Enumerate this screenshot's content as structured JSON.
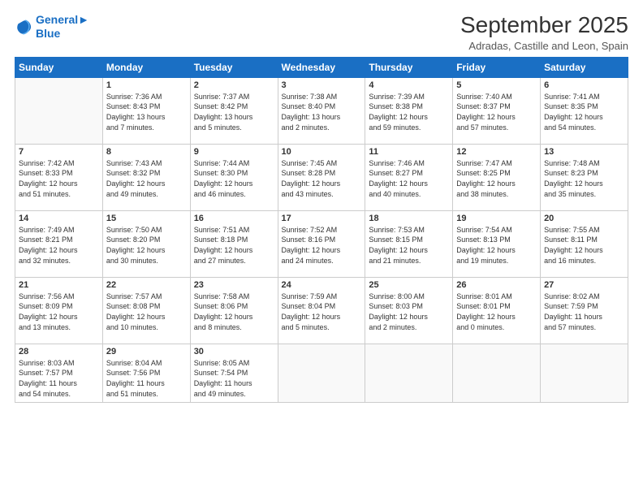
{
  "logo": {
    "line1": "General",
    "line2": "Blue"
  },
  "title": "September 2025",
  "subtitle": "Adradas, Castille and Leon, Spain",
  "days_of_week": [
    "Sunday",
    "Monday",
    "Tuesday",
    "Wednesday",
    "Thursday",
    "Friday",
    "Saturday"
  ],
  "weeks": [
    [
      {
        "num": "",
        "info": ""
      },
      {
        "num": "1",
        "info": "Sunrise: 7:36 AM\nSunset: 8:43 PM\nDaylight: 13 hours\nand 7 minutes."
      },
      {
        "num": "2",
        "info": "Sunrise: 7:37 AM\nSunset: 8:42 PM\nDaylight: 13 hours\nand 5 minutes."
      },
      {
        "num": "3",
        "info": "Sunrise: 7:38 AM\nSunset: 8:40 PM\nDaylight: 13 hours\nand 2 minutes."
      },
      {
        "num": "4",
        "info": "Sunrise: 7:39 AM\nSunset: 8:38 PM\nDaylight: 12 hours\nand 59 minutes."
      },
      {
        "num": "5",
        "info": "Sunrise: 7:40 AM\nSunset: 8:37 PM\nDaylight: 12 hours\nand 57 minutes."
      },
      {
        "num": "6",
        "info": "Sunrise: 7:41 AM\nSunset: 8:35 PM\nDaylight: 12 hours\nand 54 minutes."
      }
    ],
    [
      {
        "num": "7",
        "info": "Sunrise: 7:42 AM\nSunset: 8:33 PM\nDaylight: 12 hours\nand 51 minutes."
      },
      {
        "num": "8",
        "info": "Sunrise: 7:43 AM\nSunset: 8:32 PM\nDaylight: 12 hours\nand 49 minutes."
      },
      {
        "num": "9",
        "info": "Sunrise: 7:44 AM\nSunset: 8:30 PM\nDaylight: 12 hours\nand 46 minutes."
      },
      {
        "num": "10",
        "info": "Sunrise: 7:45 AM\nSunset: 8:28 PM\nDaylight: 12 hours\nand 43 minutes."
      },
      {
        "num": "11",
        "info": "Sunrise: 7:46 AM\nSunset: 8:27 PM\nDaylight: 12 hours\nand 40 minutes."
      },
      {
        "num": "12",
        "info": "Sunrise: 7:47 AM\nSunset: 8:25 PM\nDaylight: 12 hours\nand 38 minutes."
      },
      {
        "num": "13",
        "info": "Sunrise: 7:48 AM\nSunset: 8:23 PM\nDaylight: 12 hours\nand 35 minutes."
      }
    ],
    [
      {
        "num": "14",
        "info": "Sunrise: 7:49 AM\nSunset: 8:21 PM\nDaylight: 12 hours\nand 32 minutes."
      },
      {
        "num": "15",
        "info": "Sunrise: 7:50 AM\nSunset: 8:20 PM\nDaylight: 12 hours\nand 30 minutes."
      },
      {
        "num": "16",
        "info": "Sunrise: 7:51 AM\nSunset: 8:18 PM\nDaylight: 12 hours\nand 27 minutes."
      },
      {
        "num": "17",
        "info": "Sunrise: 7:52 AM\nSunset: 8:16 PM\nDaylight: 12 hours\nand 24 minutes."
      },
      {
        "num": "18",
        "info": "Sunrise: 7:53 AM\nSunset: 8:15 PM\nDaylight: 12 hours\nand 21 minutes."
      },
      {
        "num": "19",
        "info": "Sunrise: 7:54 AM\nSunset: 8:13 PM\nDaylight: 12 hours\nand 19 minutes."
      },
      {
        "num": "20",
        "info": "Sunrise: 7:55 AM\nSunset: 8:11 PM\nDaylight: 12 hours\nand 16 minutes."
      }
    ],
    [
      {
        "num": "21",
        "info": "Sunrise: 7:56 AM\nSunset: 8:09 PM\nDaylight: 12 hours\nand 13 minutes."
      },
      {
        "num": "22",
        "info": "Sunrise: 7:57 AM\nSunset: 8:08 PM\nDaylight: 12 hours\nand 10 minutes."
      },
      {
        "num": "23",
        "info": "Sunrise: 7:58 AM\nSunset: 8:06 PM\nDaylight: 12 hours\nand 8 minutes."
      },
      {
        "num": "24",
        "info": "Sunrise: 7:59 AM\nSunset: 8:04 PM\nDaylight: 12 hours\nand 5 minutes."
      },
      {
        "num": "25",
        "info": "Sunrise: 8:00 AM\nSunset: 8:03 PM\nDaylight: 12 hours\nand 2 minutes."
      },
      {
        "num": "26",
        "info": "Sunrise: 8:01 AM\nSunset: 8:01 PM\nDaylight: 12 hours\nand 0 minutes."
      },
      {
        "num": "27",
        "info": "Sunrise: 8:02 AM\nSunset: 7:59 PM\nDaylight: 11 hours\nand 57 minutes."
      }
    ],
    [
      {
        "num": "28",
        "info": "Sunrise: 8:03 AM\nSunset: 7:57 PM\nDaylight: 11 hours\nand 54 minutes."
      },
      {
        "num": "29",
        "info": "Sunrise: 8:04 AM\nSunset: 7:56 PM\nDaylight: 11 hours\nand 51 minutes."
      },
      {
        "num": "30",
        "info": "Sunrise: 8:05 AM\nSunset: 7:54 PM\nDaylight: 11 hours\nand 49 minutes."
      },
      {
        "num": "",
        "info": ""
      },
      {
        "num": "",
        "info": ""
      },
      {
        "num": "",
        "info": ""
      },
      {
        "num": "",
        "info": ""
      }
    ]
  ]
}
